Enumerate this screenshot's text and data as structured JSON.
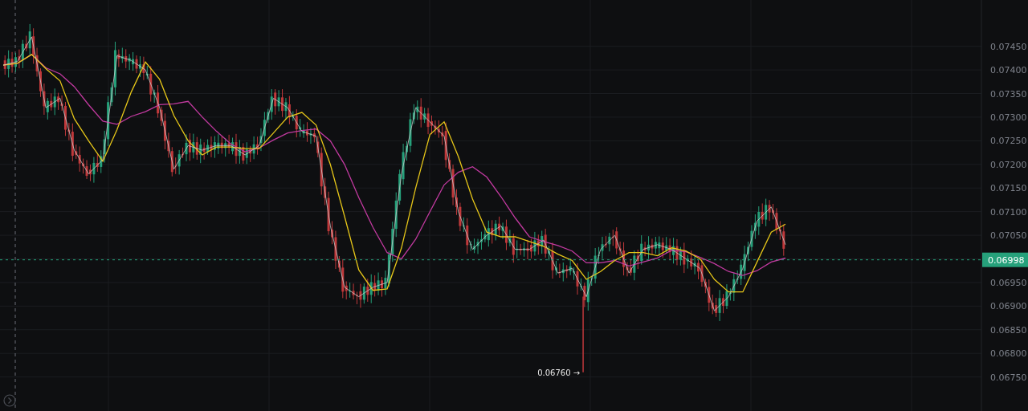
{
  "price_axis": {
    "labels": [
      "0.07450",
      "0.07400",
      "0.07350",
      "0.07300",
      "0.07250",
      "0.07200",
      "0.07150",
      "0.07100",
      "0.07050",
      "0.06950",
      "0.06900",
      "0.06850",
      "0.06800",
      "0.06750"
    ]
  },
  "last_price": "0.06998",
  "low_marker": "0.06760 →"
}
